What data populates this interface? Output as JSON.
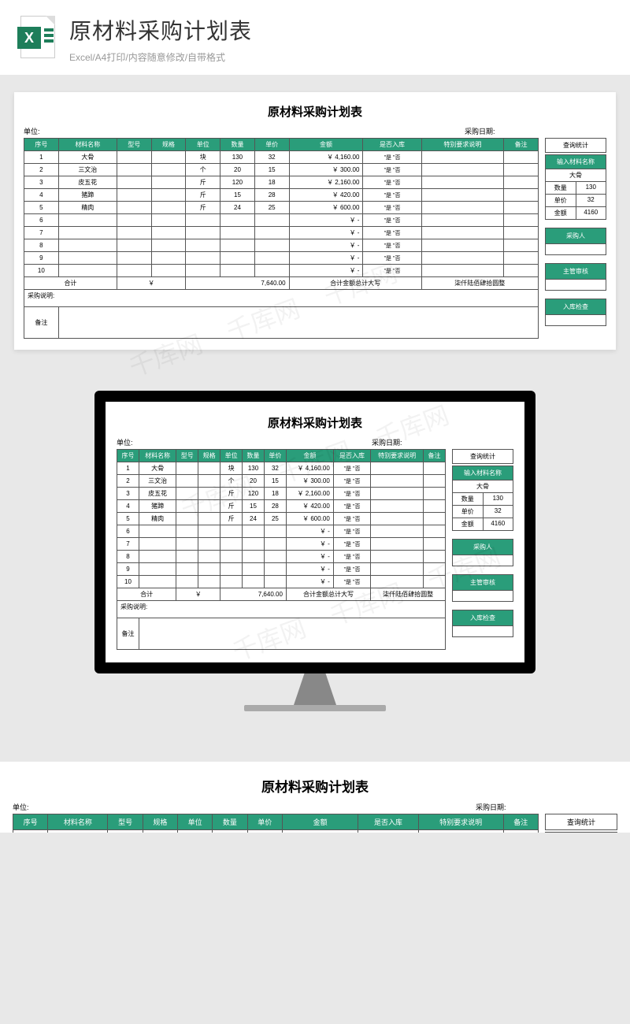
{
  "hero": {
    "title": "原材料采购计划表",
    "subtitle": "Excel/A4打印/内容随意修改/自带格式"
  },
  "sheet": {
    "title": "原材料采购计划表",
    "unit_label": "单位:",
    "date_label": "采购日期:",
    "headers": [
      "序号",
      "材料名称",
      "型号",
      "规格",
      "单位",
      "数量",
      "单价",
      "金额",
      "是否入库",
      "特别要求说明",
      "备注"
    ],
    "rows": [
      {
        "no": "1",
        "name": "大骨",
        "model": "",
        "spec": "",
        "unit": "块",
        "qty": "130",
        "price": "32",
        "amount": "￥  4,160.00",
        "yes": "是",
        "no_": "否",
        "req": "",
        "note": ""
      },
      {
        "no": "2",
        "name": "三文治",
        "model": "",
        "spec": "",
        "unit": "个",
        "qty": "20",
        "price": "15",
        "amount": "￥    300.00",
        "yes": "是",
        "no_": "否",
        "req": "",
        "note": ""
      },
      {
        "no": "3",
        "name": "皮五花",
        "model": "",
        "spec": "",
        "unit": "斤",
        "qty": "120",
        "price": "18",
        "amount": "￥  2,160.00",
        "yes": "是",
        "no_": "否",
        "req": "",
        "note": ""
      },
      {
        "no": "4",
        "name": "猪蹄",
        "model": "",
        "spec": "",
        "unit": "斤",
        "qty": "15",
        "price": "28",
        "amount": "￥    420.00",
        "yes": "是",
        "no_": "否",
        "req": "",
        "note": ""
      },
      {
        "no": "5",
        "name": "精肉",
        "model": "",
        "spec": "",
        "unit": "斤",
        "qty": "24",
        "price": "25",
        "amount": "￥    600.00",
        "yes": "是",
        "no_": "否",
        "req": "",
        "note": ""
      },
      {
        "no": "6",
        "name": "",
        "model": "",
        "spec": "",
        "unit": "",
        "qty": "",
        "price": "",
        "amount": "￥         -",
        "yes": "是",
        "no_": "否",
        "req": "",
        "note": ""
      },
      {
        "no": "7",
        "name": "",
        "model": "",
        "spec": "",
        "unit": "",
        "qty": "",
        "price": "",
        "amount": "￥         -",
        "yes": "是",
        "no_": "否",
        "req": "",
        "note": ""
      },
      {
        "no": "8",
        "name": "",
        "model": "",
        "spec": "",
        "unit": "",
        "qty": "",
        "price": "",
        "amount": "￥         -",
        "yes": "是",
        "no_": "否",
        "req": "",
        "note": ""
      },
      {
        "no": "9",
        "name": "",
        "model": "",
        "spec": "",
        "unit": "",
        "qty": "",
        "price": "",
        "amount": "￥         -",
        "yes": "是",
        "no_": "否",
        "req": "",
        "note": ""
      },
      {
        "no": "10",
        "name": "",
        "model": "",
        "spec": "",
        "unit": "",
        "qty": "",
        "price": "",
        "amount": "￥         -",
        "yes": "是",
        "no_": "否",
        "req": "",
        "note": ""
      }
    ],
    "total_label": "合计",
    "total_sym": "￥",
    "total_amount": "7,640.00",
    "total_cn_label": "合计金额总计大写",
    "total_cn": "柒仟陆佰肆拾圆整",
    "note_label": "采购说明:",
    "remark_label": "备注"
  },
  "side": {
    "stat_title": "查询统计",
    "input_label": "输入材料名称",
    "input_value": "大骨",
    "qty_label": "数量",
    "qty_value": "130",
    "price_label": "单价",
    "price_value": "32",
    "amount_label": "金额",
    "amount_value": "4160",
    "btn1": "采购人",
    "btn2": "主管审核",
    "btn3": "入库检查"
  },
  "chart_data": {
    "type": "table",
    "title": "原材料采购计划表",
    "columns": [
      "序号",
      "材料名称",
      "单位",
      "数量",
      "单价",
      "金额"
    ],
    "rows": [
      [
        1,
        "大骨",
        "块",
        130,
        32,
        4160.0
      ],
      [
        2,
        "三文治",
        "个",
        20,
        15,
        300.0
      ],
      [
        3,
        "皮五花",
        "斤",
        120,
        18,
        2160.0
      ],
      [
        4,
        "猪蹄",
        "斤",
        15,
        28,
        420.0
      ],
      [
        5,
        "精肉",
        "斤",
        24,
        25,
        600.0
      ]
    ],
    "total": 7640.0,
    "total_cn": "柒仟陆佰肆拾圆整"
  }
}
